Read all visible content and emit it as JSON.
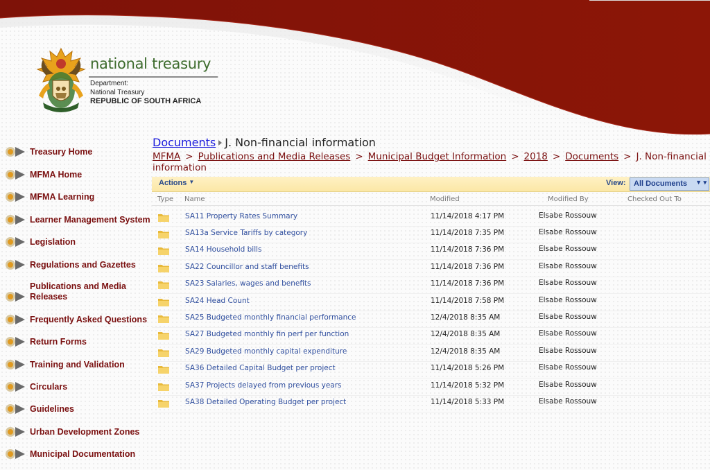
{
  "brand": {
    "name": "national treasury",
    "line1": "Department:",
    "line2": "National Treasury",
    "line3": "REPUBLIC OF SOUTH AFRICA"
  },
  "nav": [
    {
      "label": "Treasury Home"
    },
    {
      "label": "MFMA Home"
    },
    {
      "label": "MFMA Learning"
    },
    {
      "label": "Learner Management System"
    },
    {
      "label": "Legislation"
    },
    {
      "label": "Regulations and Gazettes"
    },
    {
      "label": "Publications and Media Releases"
    },
    {
      "label": "Frequently Asked Questions"
    },
    {
      "label": "Return Forms"
    },
    {
      "label": "Training and Validation"
    },
    {
      "label": "Circulars"
    },
    {
      "label": "Guidelines"
    },
    {
      "label": "Urban Development Zones"
    },
    {
      "label": "Municipal Documentation"
    }
  ],
  "title": {
    "library": "Documents",
    "folder": "J. Non-financial information"
  },
  "breadcrumb": {
    "items": [
      "MFMA",
      "Publications and Media Releases",
      "Municipal Budget Information",
      "2018",
      "Documents"
    ],
    "current": "J. Non-financial information"
  },
  "toolbar": {
    "actions_label": "Actions",
    "view_label": "View:",
    "view_value": "All Documents"
  },
  "table": {
    "columns": {
      "type": "Type",
      "name": "Name",
      "modified": "Modified",
      "modified_by": "Modified By",
      "checked_out": "Checked Out To"
    },
    "rows": [
      {
        "name": "SA11 Property Rates Summary",
        "modified": "11/14/2018 4:17 PM",
        "modified_by": "Elsabe Rossouw"
      },
      {
        "name": "SA13a Service Tariffs by category",
        "modified": "11/14/2018 7:35 PM",
        "modified_by": "Elsabe Rossouw"
      },
      {
        "name": "SA14 Household bills",
        "modified": "11/14/2018 7:36 PM",
        "modified_by": "Elsabe Rossouw"
      },
      {
        "name": "SA22 Councillor and staff benefits",
        "modified": "11/14/2018 7:36 PM",
        "modified_by": "Elsabe Rossouw"
      },
      {
        "name": "SA23 Salaries, wages and benefits",
        "modified": "11/14/2018 7:36 PM",
        "modified_by": "Elsabe Rossouw"
      },
      {
        "name": "SA24 Head Count",
        "modified": "11/14/2018 7:58 PM",
        "modified_by": "Elsabe Rossouw"
      },
      {
        "name": "SA25 Budgeted monthly financial performance",
        "modified": "12/4/2018 8:35 AM",
        "modified_by": "Elsabe Rossouw"
      },
      {
        "name": "SA27 Budgeted monthly fin perf per function",
        "modified": "12/4/2018 8:35 AM",
        "modified_by": "Elsabe Rossouw"
      },
      {
        "name": "SA29 Budgeted monthly capital expenditure",
        "modified": "12/4/2018 8:35 AM",
        "modified_by": "Elsabe Rossouw"
      },
      {
        "name": "SA36 Detailed Capital Budget per project",
        "modified": "11/14/2018 5:26 PM",
        "modified_by": "Elsabe Rossouw"
      },
      {
        "name": "SA37 Projects delayed from previous years",
        "modified": "11/14/2018 5:32 PM",
        "modified_by": "Elsabe Rossouw"
      },
      {
        "name": "SA38 Detailed Operating Budget per project",
        "modified": "11/14/2018 5:33 PM",
        "modified_by": "Elsabe Rossouw"
      }
    ]
  },
  "colors": {
    "banner": "#8c1508",
    "nav_text": "#7a1010",
    "link_blue": "#2f4e9e",
    "brand_green": "#3d6b2d"
  },
  "icons": {
    "nav": "bullet-emblem-icon",
    "row": "folder-icon"
  }
}
